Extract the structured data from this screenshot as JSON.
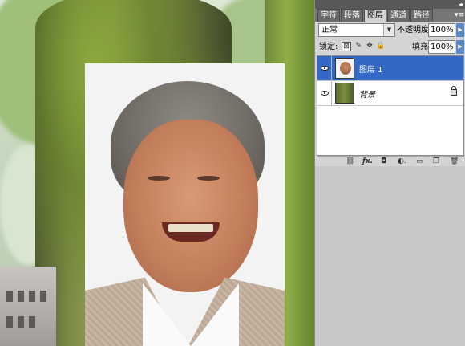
{
  "panel": {
    "collapse_glyph": "◂◂",
    "tabs": [
      {
        "label": "字符",
        "active": false
      },
      {
        "label": "段落",
        "active": false
      },
      {
        "label": "图层",
        "active": true
      },
      {
        "label": "通道",
        "active": false
      },
      {
        "label": "路径",
        "active": false
      }
    ],
    "tabs_menu_glyph": "▾≡",
    "blend_mode": "正常",
    "opacity_label": "不透明度:",
    "opacity_value": "100%",
    "lock_label": "锁定:",
    "fill_label": "填充:",
    "fill_value": "100%",
    "lock_icons": [
      "lock-transparent-icon",
      "lock-pixels-icon",
      "lock-position-icon",
      "lock-all-icon"
    ],
    "layers": [
      {
        "name": "图层 1",
        "selected": true,
        "visible": true,
        "locked": false,
        "thumb": "portrait"
      },
      {
        "name": "背景",
        "selected": false,
        "visible": true,
        "locked": true,
        "thumb": "background"
      }
    ],
    "bottom_icons": [
      "link-layers-icon",
      "fx-icon",
      "add-mask-icon",
      "adjustment-layer-icon",
      "new-group-icon",
      "new-layer-icon",
      "trash-icon"
    ],
    "bottom_glyphs": {
      "link": "⛓",
      "fx": "ƒx.",
      "mask": "◘",
      "adjust": "◐.",
      "group": "▭",
      "new": "❐",
      "trash": "🗑"
    }
  },
  "colors": {
    "panel_bg": "#d4d4d4",
    "selected_layer": "#3368c7",
    "workspace_bg": "#b4b4b4"
  }
}
